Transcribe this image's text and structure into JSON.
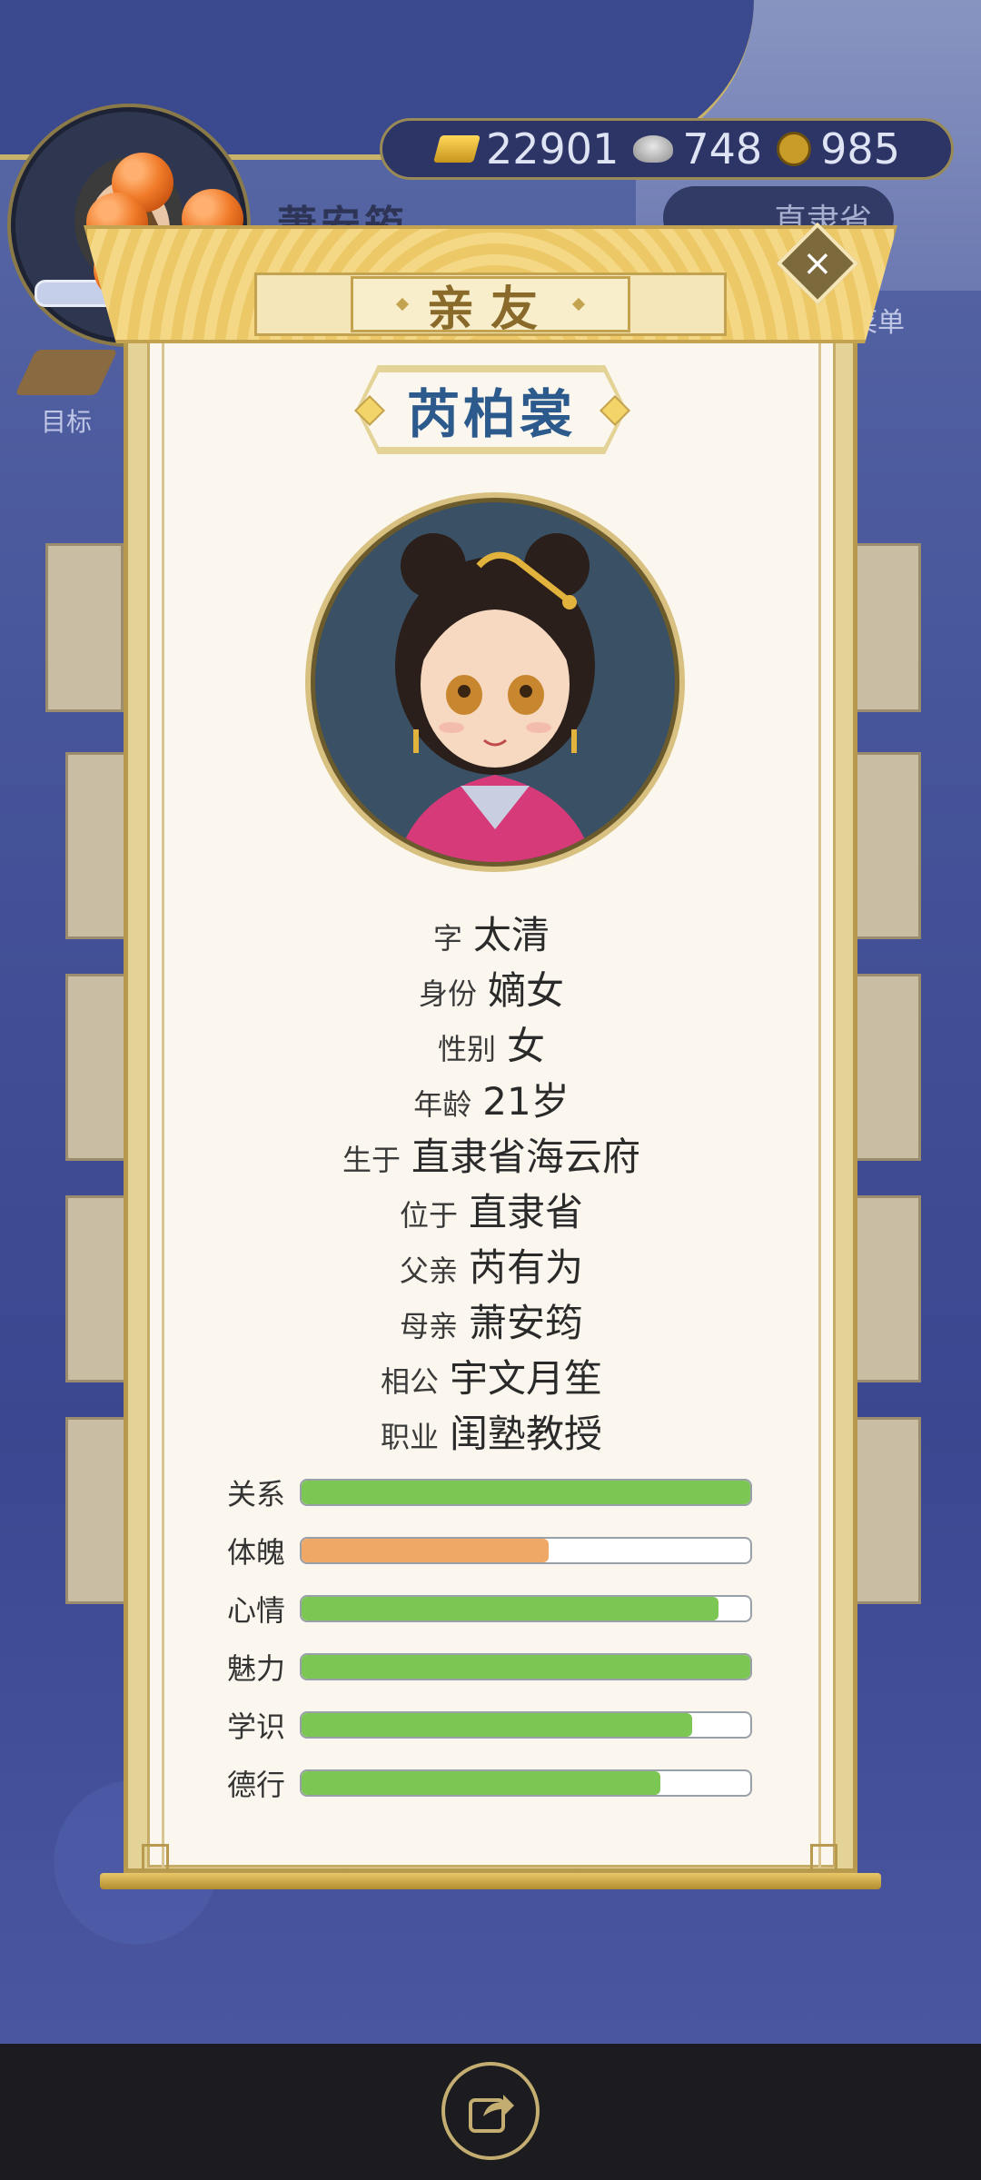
{
  "hud": {
    "player_name": "萧安筠",
    "currency": [
      {
        "icon": "gold-ingot-icon",
        "value": "22901"
      },
      {
        "icon": "silver-ingot-icon",
        "value": "748"
      },
      {
        "icon": "copper-coin-icon",
        "value": "985"
      }
    ],
    "region": "直隶省",
    "goal_label": "目标",
    "menu_label": "菜单"
  },
  "modal": {
    "title": "亲友",
    "name": "芮柏裳",
    "info": [
      {
        "label": "字",
        "value": "太清"
      },
      {
        "label": "身份",
        "value": "嫡女"
      },
      {
        "label": "性别",
        "value": "女"
      },
      {
        "label": "年龄",
        "value": "21岁"
      },
      {
        "label": "生于",
        "value": "直隶省海云府"
      },
      {
        "label": "位于",
        "value": "直隶省"
      },
      {
        "label": "父亲",
        "value": "芮有为"
      },
      {
        "label": "母亲",
        "value": "萧安筠"
      },
      {
        "label": "相公",
        "value": "宇文月笙"
      },
      {
        "label": "职业",
        "value": "闺塾教授"
      }
    ],
    "stats": [
      {
        "label": "关系",
        "fill": 1.0,
        "color": "#7cc653"
      },
      {
        "label": "体魄",
        "fill": 0.55,
        "color": "#f0a866"
      },
      {
        "label": "心情",
        "fill": 0.93,
        "color": "#7cc653"
      },
      {
        "label": "魅力",
        "fill": 1.0,
        "color": "#7cc653"
      },
      {
        "label": "学识",
        "fill": 0.87,
        "color": "#7cc653"
      },
      {
        "label": "德行",
        "fill": 0.8,
        "color": "#7cc653"
      }
    ]
  },
  "colors": {
    "accent_gold": "#c4a350",
    "name_blue": "#2d5a8c",
    "bar_green": "#7cc653",
    "bar_orange": "#f0a866"
  }
}
